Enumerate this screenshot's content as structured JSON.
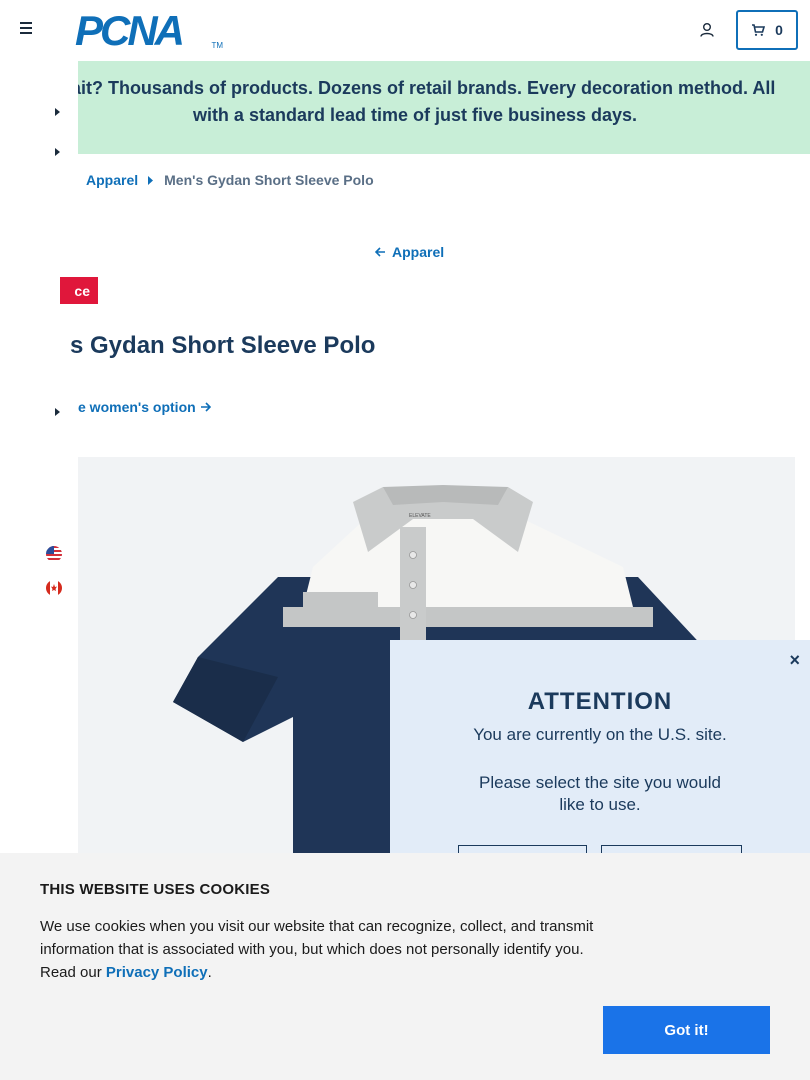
{
  "header": {
    "logo_text": "PCNA",
    "logo_tm": "TM",
    "cart_count": "0"
  },
  "promo": {
    "line1": "Wait? Thousands of products. Dozens of retail brands. Every decoration method. All",
    "line2": "with a standard lead time of just five business days."
  },
  "breadcrumb": {
    "items": [
      "Apparel",
      "Men's Gydan Short Sleeve Polo"
    ]
  },
  "back_link": "Apparel",
  "badge": "ce",
  "product": {
    "title": "s Gydan Short Sleeve Polo",
    "womens_link": "e women's option",
    "shirt_brand_label": "ELEVATE"
  },
  "modal": {
    "close_label": "×",
    "title": "ATTENTION",
    "line1": "You are currently on the U.S. site.",
    "line2": "Please select the site you would like to use."
  },
  "cookie": {
    "title": "THIS WEBSITE USES COOKIES",
    "body": "We use cookies when you visit our website that can recognize, collect, and transmit information that is associated with you, but which does not personally identify you. Read our ",
    "link": "Privacy Policy",
    "period": ".",
    "button": "Got it!"
  },
  "colors": {
    "brand_blue": "#0f6fb8",
    "navy": "#1b3a5c",
    "promo_green": "#c8eed7",
    "badge_red": "#e0173b",
    "modal_bg": "#e2ecf8",
    "cookie_button": "#1a73e8"
  },
  "icons": [
    "menu-icon",
    "account-icon",
    "cart-icon",
    "chevron-right-icon",
    "arrow-left-icon",
    "arrow-right-icon",
    "us-flag-icon",
    "ca-flag-icon",
    "close-icon"
  ]
}
